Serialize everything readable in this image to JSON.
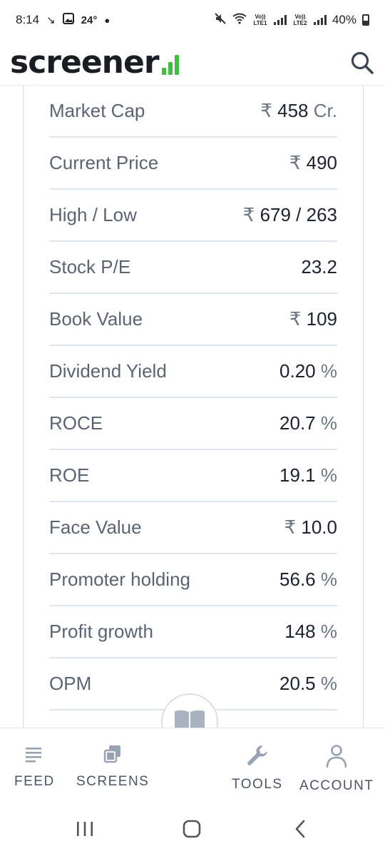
{
  "status_bar": {
    "time": "8:14",
    "temperature": "24°",
    "sim1_label": "Vo)) LTE1",
    "sim2_label": "Vo)) LTE2",
    "battery": "40%"
  },
  "header": {
    "logo_text": "screener",
    "accent_color": "#3fbf3f"
  },
  "ratios": [
    {
      "label": "Market Cap",
      "prefix": "₹",
      "value": "458",
      "unit": "Cr."
    },
    {
      "label": "Current Price",
      "prefix": "₹",
      "value": "490",
      "unit": ""
    },
    {
      "label": "High / Low",
      "prefix": "₹",
      "value": "679 / 263",
      "unit": ""
    },
    {
      "label": "Stock P/E",
      "prefix": "",
      "value": "23.2",
      "unit": ""
    },
    {
      "label": "Book Value",
      "prefix": "₹",
      "value": "109",
      "unit": ""
    },
    {
      "label": "Dividend Yield",
      "prefix": "",
      "value": "0.20",
      "unit": "%"
    },
    {
      "label": "ROCE",
      "prefix": "",
      "value": "20.7",
      "unit": "%"
    },
    {
      "label": "ROE",
      "prefix": "",
      "value": "19.1",
      "unit": "%"
    },
    {
      "label": "Face Value",
      "prefix": "₹",
      "value": "10.0",
      "unit": ""
    },
    {
      "label": "Promoter holding",
      "prefix": "",
      "value": "56.6",
      "unit": "%"
    },
    {
      "label": "Profit growth",
      "prefix": "",
      "value": "148",
      "unit": "%"
    },
    {
      "label": "OPM",
      "prefix": "",
      "value": "20.5",
      "unit": "%"
    }
  ],
  "bottom_nav": {
    "feed": "FEED",
    "screens": "SCREENS",
    "tools": "TOOLS",
    "account": "ACCOUNT"
  },
  "icons": {
    "search": "search-icon",
    "feed": "feed-icon",
    "screens": "screens-icon",
    "book": "book-icon",
    "tools": "wrench-icon",
    "account": "user-icon"
  }
}
